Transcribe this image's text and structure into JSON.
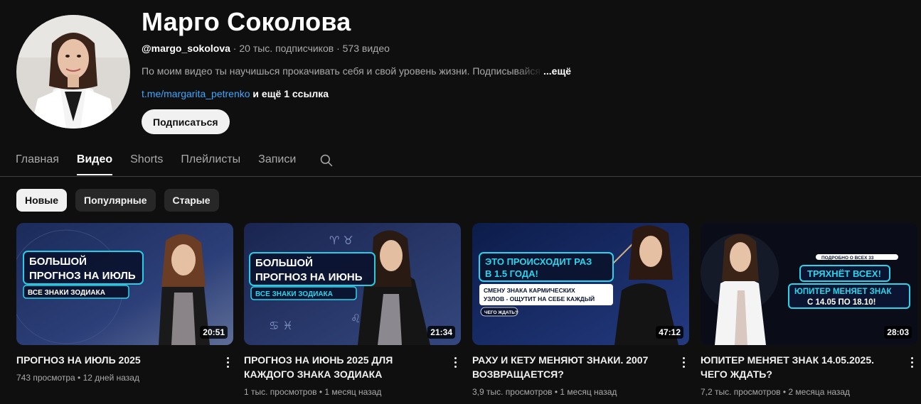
{
  "channel": {
    "name": "Марго Соколова",
    "handle": "@margo_sokolova",
    "subscribers": "20 тыс. подписчиков",
    "video_count": "573 видео",
    "description": "По моим видео ты научишься прокачивать себя и свой уровень жизни. Подписывайся",
    "description_more": "...ещё",
    "link": "t.me/margarita_petrenko",
    "more_links": "и ещё 1 ссылка",
    "subscribe_label": "Подписаться",
    "separator": " · "
  },
  "tabs": [
    {
      "label": "Главная",
      "active": false
    },
    {
      "label": "Видео",
      "active": true
    },
    {
      "label": "Shorts",
      "active": false
    },
    {
      "label": "Плейлисты",
      "active": false
    },
    {
      "label": "Записи",
      "active": false
    }
  ],
  "chips": [
    {
      "label": "Новые",
      "active": true
    },
    {
      "label": "Популярные",
      "active": false
    },
    {
      "label": "Старые",
      "active": false
    }
  ],
  "videos": [
    {
      "title": "ПРОГНОЗ НА ИЮЛЬ 2025",
      "duration": "20:51",
      "views": "743 просмотра",
      "age": "12 дней назад",
      "stats_sep": " • ",
      "thumb_lines": [
        "БОЛЬШОЙ",
        "ПРОГНОЗ НА ИЮЛЬ"
      ],
      "thumb_sub": "ВСЕ ЗНАКИ ЗОДИАКА"
    },
    {
      "title": "ПРОГНОЗ НА ИЮНЬ 2025 ДЛЯ КАЖДОГО ЗНАКА ЗОДИАКА",
      "duration": "21:34",
      "views": "1 тыс. просмотров",
      "age": "1 месяц назад",
      "stats_sep": " • ",
      "thumb_lines": [
        "БОЛЬШОЙ",
        "ПРОГНОЗ НА ИЮНЬ"
      ],
      "thumb_sub": "ВСЕ ЗНАКИ ЗОДИАКА"
    },
    {
      "title": "РАХУ И КЕТУ МЕНЯЮТ ЗНАКИ. 2007 ВОЗВРАЩАЕТСЯ?",
      "duration": "47:12",
      "views": "3,9 тыс. просмотров",
      "age": "1 месяц назад",
      "stats_sep": " • ",
      "thumb_lines": [
        "ЭТО ПРОИСХОДИТ РАЗ",
        "В 1.5 ГОДА!"
      ],
      "thumb_sub_lines": [
        "СМЕНУ ЗНАКА КАРМИЧЕСКИХ",
        "УЗЛОВ - ОЩУТИТ НА СЕБЕ КАЖДЫЙ"
      ],
      "thumb_tag": "ЧЕГО ЖДАТЬ?"
    },
    {
      "title": "ЮПИТЕР МЕНЯЕТ ЗНАК 14.05.2025. ЧЕГО ЖДАТЬ?",
      "duration": "28:03",
      "views": "7,2 тыс. просмотров",
      "age": "2 месяца назад",
      "stats_sep": " • ",
      "thumb_top": "ПОДРОБНО О ВСЕХ 33",
      "thumb_lines": [
        "ТРЯХНЁТ ВСЕХ!",
        "ЮПИТЕР МЕНЯЕТ ЗНАК",
        "С 14.05 ПО 18.10!"
      ]
    }
  ],
  "icons": {
    "search": "search-icon",
    "more": "more-vert-icon",
    "avatar": "avatar-photo"
  },
  "colors": {
    "background": "#0f0f0f",
    "link": "#3ea6ff",
    "thumb_accent": "#27d6ee"
  }
}
